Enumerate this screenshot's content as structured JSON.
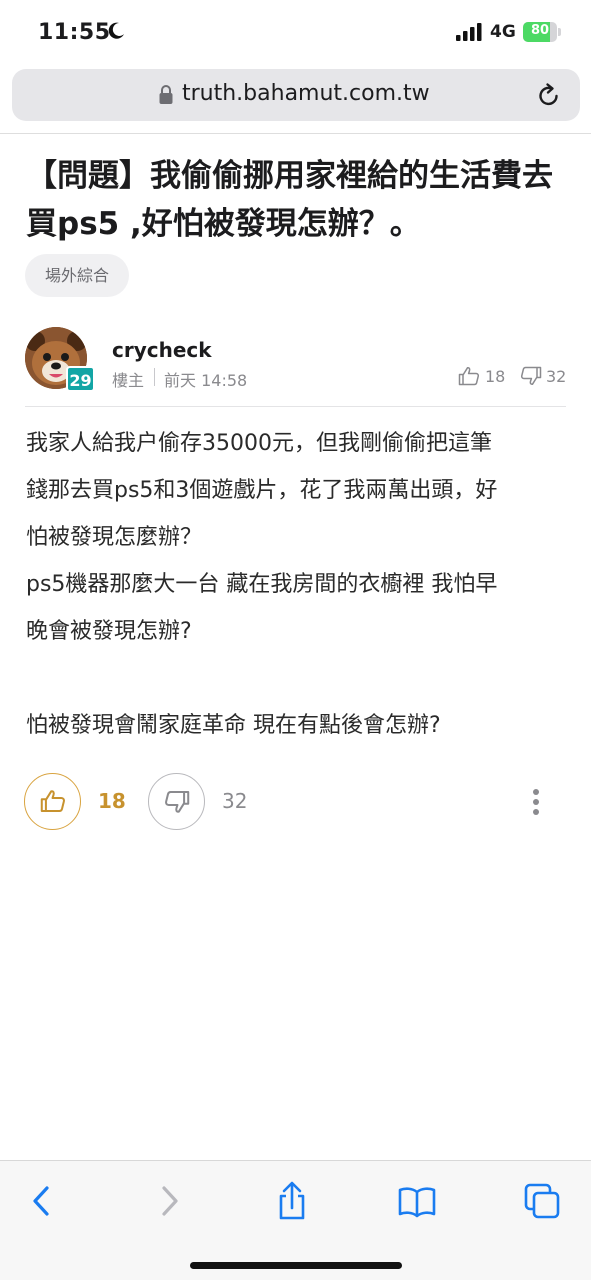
{
  "status_bar": {
    "time": "11:55",
    "network": "4G",
    "battery_text": "80",
    "battery_level": 0.8,
    "battery_color": "#4cd964"
  },
  "browser": {
    "url": "truth.bahamut.com.tw",
    "lock_icon": "lock-icon",
    "reload_icon": "reload-icon"
  },
  "post": {
    "title": "【問題】我偷偷挪用家裡給的生活費去買ps5 ,好怕被發現怎辦？。",
    "board_tag": "場外綜合",
    "author": {
      "name": "crycheck",
      "level": "29",
      "floor": "樓主",
      "time": "前天 14:58"
    },
    "header_likes": "18",
    "header_dislikes": "32",
    "body_lines": [
      "我家人給我户偷存35000元，但我剛偷偷把這筆",
      "錢那去買ps5和3個遊戲片，花了我兩萬出頭，好",
      "怕被發現怎麼辦？",
      "ps5機器那麼大一台 藏在我房間的衣櫥裡 我怕早",
      "晚會被發現怎辦?",
      "",
      "怕被發現會鬧家庭革命 現在有點後會怎辦?"
    ],
    "likes": "18",
    "dislikes": "32"
  },
  "colors": {
    "like_accent": "#d9a441",
    "level_badge": "#12a5a5",
    "ios_blue": "#1a7cf0"
  },
  "toolbar": {
    "back_icon": "back-chevron-icon",
    "forward_icon": "forward-chevron-icon",
    "share_icon": "share-icon",
    "bookmarks_icon": "bookmarks-icon",
    "tabs_icon": "tabs-icon"
  }
}
